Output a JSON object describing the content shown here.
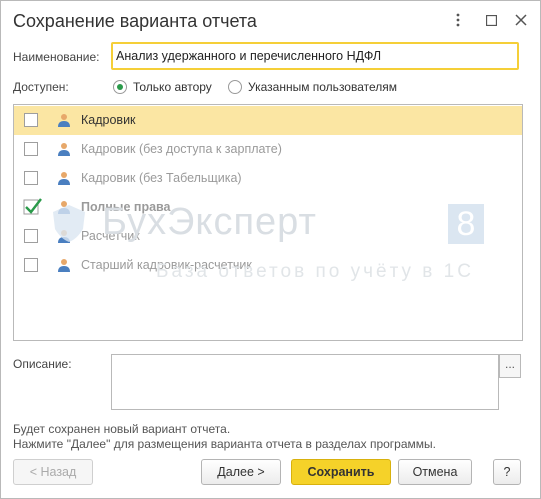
{
  "window": {
    "title": "Сохранение варианта отчета",
    "controls": [
      "more-icon",
      "maximize-icon",
      "close-icon"
    ]
  },
  "name_field": {
    "label": "Наименование:",
    "value": "Анализ удержанного и перечисленного НДФЛ"
  },
  "access": {
    "label": "Доступен:",
    "options": [
      {
        "label": "Только автору",
        "selected": true
      },
      {
        "label": "Указанным пользователям",
        "selected": false
      }
    ]
  },
  "roles": [
    {
      "label": "Кадровик",
      "checked": false,
      "selected": true,
      "style": "dark"
    },
    {
      "label": "Кадровик (без доступа к зарплате)",
      "checked": false,
      "selected": false,
      "style": "grey"
    },
    {
      "label": "Кадровик (без Табельщика)",
      "checked": false,
      "selected": false,
      "style": "grey"
    },
    {
      "label": "Полные права",
      "checked": true,
      "selected": false,
      "style": "bold"
    },
    {
      "label": "Расчетчик",
      "checked": false,
      "selected": false,
      "style": "grey"
    },
    {
      "label": "Старший кадровик-расчетчик",
      "checked": false,
      "selected": false,
      "style": "grey"
    }
  ],
  "description": {
    "label": "Описание:",
    "value": "",
    "button_label": "..."
  },
  "info": {
    "line1": "Будет сохранен новый вариант отчета.",
    "line2": "Нажмите \"Далее\" для размещения варианта отчета в разделах программы."
  },
  "buttons": {
    "back": "< Назад",
    "next": "Далее >",
    "save": "Сохранить",
    "cancel": "Отмена",
    "help": "?"
  },
  "watermark": {
    "brand": "БухЭксперт",
    "digit": "8",
    "tagline": "База ответов по учёту в 1С"
  },
  "colors": {
    "accent": "#f5d229",
    "selection": "#fbe6a3",
    "check": "#2a9a4a",
    "field_focus": "#f5cf38"
  }
}
